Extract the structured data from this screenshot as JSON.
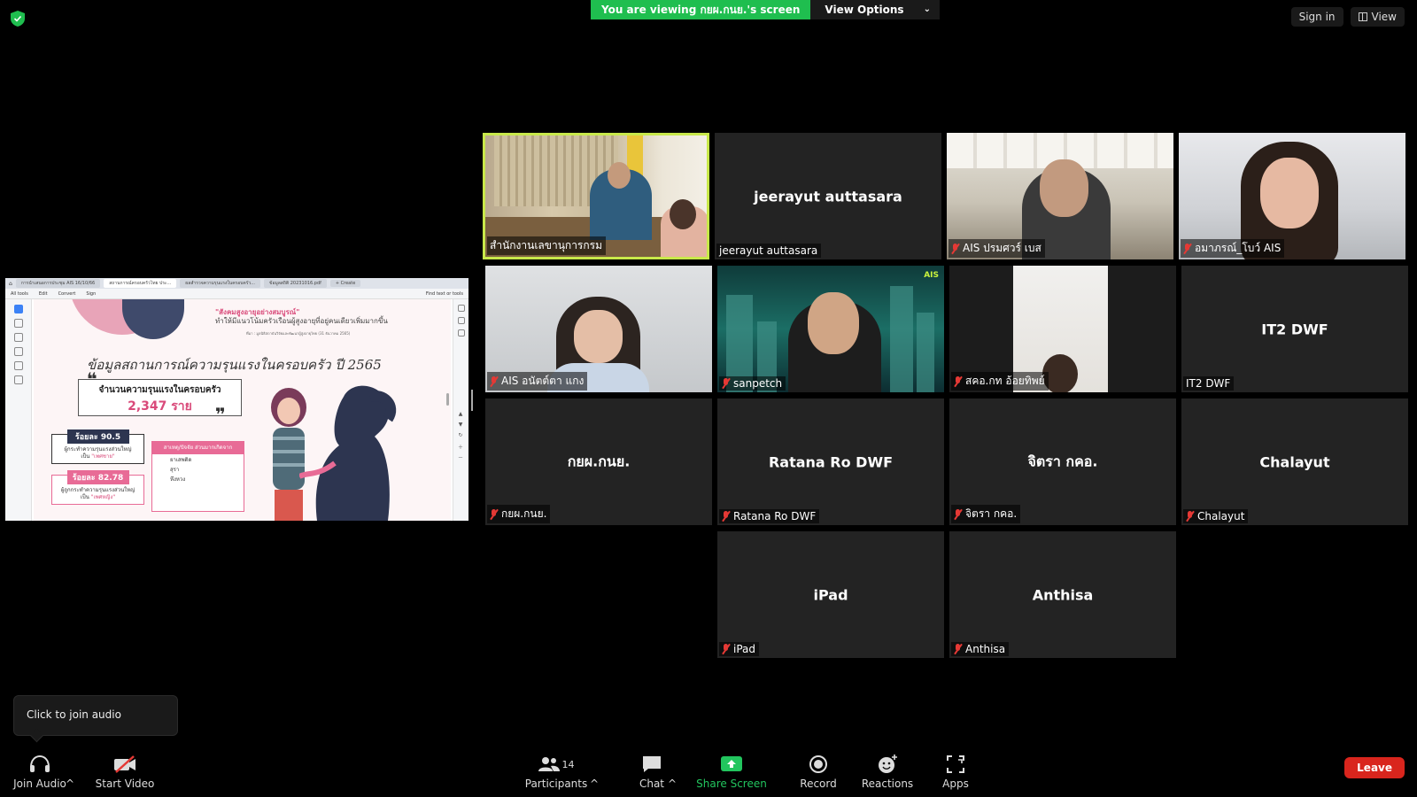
{
  "banner": {
    "viewing_text": "You are viewing กยผ.กนย.'s screen",
    "view_options": "View Options"
  },
  "top_right": {
    "sign_in": "Sign in",
    "view": "View"
  },
  "shared_screen": {
    "tabs": [
      "การนำเสนอการประชุม AIS 16/10/66",
      "สถานการณ์ครอบครัวไทย ประ...",
      "ผลสำรวจความรุนแรงในครอบครัว...",
      "ข้อมูลสถิติ 20231016.pdf"
    ],
    "create_label": "+ Create",
    "menu": [
      "All tools",
      "Edit",
      "Convert",
      "Sign"
    ],
    "find_label": "Find text or tools",
    "headline_pink": "\"สังคมสูงอายุอย่างสมบูรณ์\"",
    "headline_rest": "ทำให้มีแนวโน้มครัวเรือนผู้สูงอายุที่อยู่คนเดียวเพิ่มมากขึ้น",
    "source": "ที่มา : มูลนิธิสถาบันวิจัยและพัฒนาผู้สูงอายุไทย (31 ธันวาคม 2565)",
    "title": "ข้อมูลสถานการณ์ความรุนแรงในครอบครัว ปี 2565",
    "box_title": "จำนวนความรุนแรงในครอบครัว",
    "box_value": "2,347 ราย",
    "stat1_pct": "ร้อยละ 90.5",
    "stat1_text": "ผู้กระทำความรุนแรงส่วนใหญ่",
    "stat1_hl": "\"เพศชาย\"",
    "stat2_pct": "ร้อยละ 82.78",
    "stat2_text": "ผู้ถูกกระทำความรุนแรงส่วนใหญ่",
    "stat2_hl": "\"เพศหญิง\"",
    "cause_title": "สาเหตุ/ปัจจัย ส่วนมากเกิดจาก",
    "causes": [
      "ยาเสพติด",
      "สุรา",
      "หึงหวง"
    ],
    "prefix_pen": "เป็น"
  },
  "participants": [
    {
      "name": "สำนักงานเลขานุการกรม",
      "label": "สำนักงานเลขานุการกรม",
      "muted": false,
      "video": "room"
    },
    {
      "name": "jeerayut auttasara",
      "label": "jeerayut auttasara",
      "muted": false,
      "video": "none"
    },
    {
      "name": "AIS ปรมศวร์ เบส",
      "label": "AIS ปรมศวร์ เบส",
      "muted": true,
      "video": "office"
    },
    {
      "name": "อมาภรณ์_โบว์ AIS",
      "label": "อมาภรณ์_โบว์ AIS",
      "muted": true,
      "video": "girl"
    },
    {
      "name": "AIS อนัตต์ตา แกง",
      "label": "AIS อนัตต์ตา แกง",
      "muted": true,
      "video": "ais1"
    },
    {
      "name": "sanpetch",
      "label": "sanpetch",
      "muted": true,
      "video": "city"
    },
    {
      "name": "สคอ.กท อ้อยทิพย์",
      "label": "สคอ.กท อ้อยทิพย์",
      "muted": true,
      "video": "dark"
    },
    {
      "name": "IT2 DWF",
      "label": "IT2 DWF",
      "muted": false,
      "video": "none"
    },
    {
      "name": "กยผ.กนย.",
      "label": "กยผ.กนย.",
      "muted": true,
      "video": "none"
    },
    {
      "name": "Ratana Ro DWF",
      "label": "Ratana Ro DWF",
      "muted": true,
      "video": "none"
    },
    {
      "name": "จิตรา กคอ.",
      "label": "จิตรา กคอ.",
      "muted": true,
      "video": "none"
    },
    {
      "name": "Chalayut",
      "label": "Chalayut",
      "muted": true,
      "video": "none"
    },
    {
      "name": "iPad",
      "label": "iPad",
      "muted": true,
      "video": "none"
    },
    {
      "name": "Anthisa",
      "label": "Anthisa",
      "muted": true,
      "video": "none"
    }
  ],
  "city_logo": "AIS",
  "tooltip": "Click to join audio",
  "toolbar": {
    "join_audio": "Join Audio",
    "start_video": "Start Video",
    "participants": "Participants",
    "participant_count": "14",
    "chat": "Chat",
    "share_screen": "Share Screen",
    "record": "Record",
    "reactions": "Reactions",
    "apps": "Apps",
    "leave": "Leave"
  },
  "colors": {
    "share_green": "#22c55e",
    "active_speaker": "#c8e84a",
    "leave_red": "#d9251d",
    "muted_red": "#e53935"
  }
}
